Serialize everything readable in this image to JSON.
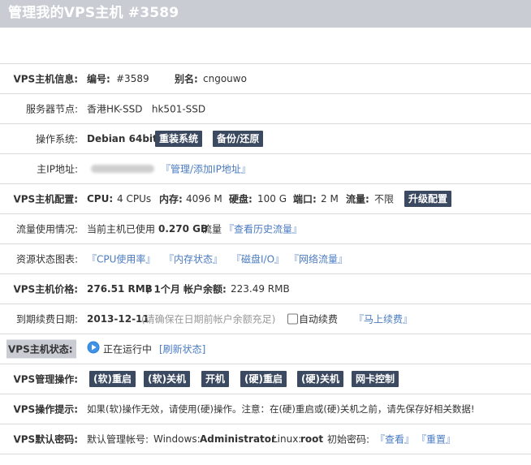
{
  "page_title": "管理我的VPS主机 #3589",
  "rows": {
    "info": {
      "label": "VPS主机信息:",
      "id_label": "编号:",
      "id_value": "#3589",
      "alias_label": "别名:",
      "alias_value": "cngouwo"
    },
    "node": {
      "label": "服务器节点:",
      "value": "香港HK-SSD   hk501-SSD"
    },
    "os": {
      "label": "操作系统:",
      "value": "Debian 64bit",
      "reinstall_btn": "重装系统",
      "backup_btn": "备份/还原"
    },
    "ip": {
      "label": "主IP地址:",
      "link": "『管理/添加IP地址』"
    },
    "config": {
      "label": "VPS主机配置:",
      "cpu_label": "CPU:",
      "cpu_value": "4 CPUs",
      "mem_label": "内存:",
      "mem_value": "4096 M",
      "disk_label": "硬盘:",
      "disk_value": "100 G",
      "port_label": "端口:",
      "port_value": "2 M",
      "traffic_label": "流量:",
      "traffic_value": "不限",
      "upgrade_btn": "升级配置"
    },
    "traffic": {
      "label": "流量使用情况:",
      "prefix": "当前主机已使用",
      "value": "0.270 GB",
      "unit": "流量",
      "link": "『查看历史流量』"
    },
    "charts": {
      "label": "资源状态图表:",
      "links": [
        "『CPU使用率』",
        "『内存状态』",
        "『磁盘I/O』",
        "『网络流量』"
      ]
    },
    "price": {
      "label": "VPS主机价格:",
      "price": "276.51 RMB",
      "period": "/ 1个月",
      "balance_label": "帐户余额:",
      "balance_value": "223.49 RMB"
    },
    "expire": {
      "label": "到期续费日期:",
      "date": "2013-12-11",
      "note": "(请确保在日期前帐户余额充足)",
      "auto_renew": "自动续费",
      "link": "『马上续费』"
    },
    "status": {
      "label": "VPS主机状态:",
      "value": "正在运行中",
      "refresh": "[刷新状态]"
    },
    "ops": {
      "label": "VPS管理操作:",
      "buttons": [
        "(软)重启",
        "(软)关机",
        "开机",
        "(硬)重启",
        "(硬)关机",
        "网卡控制"
      ]
    },
    "tips": {
      "label": "VPS操作提示:",
      "text": "如果(软)操作无效，请使用(硬)操作。注意：在(硬)重启或(硬)关机之前，请先保存好相关数据!"
    },
    "password": {
      "label": "VPS默认密码:",
      "account_label": "默认管理帐号:",
      "win_label": "Windows:",
      "win_value": "Administrator",
      "linux_label": "Linux:",
      "linux_value": "root",
      "init_label": "初始密码:",
      "view_link": "『查看』",
      "reset_link": "『重置』"
    }
  },
  "colors": {
    "button_bg": "#3b4a61",
    "link": "#4a7bc1",
    "title_bar": "#c9ccd3"
  }
}
